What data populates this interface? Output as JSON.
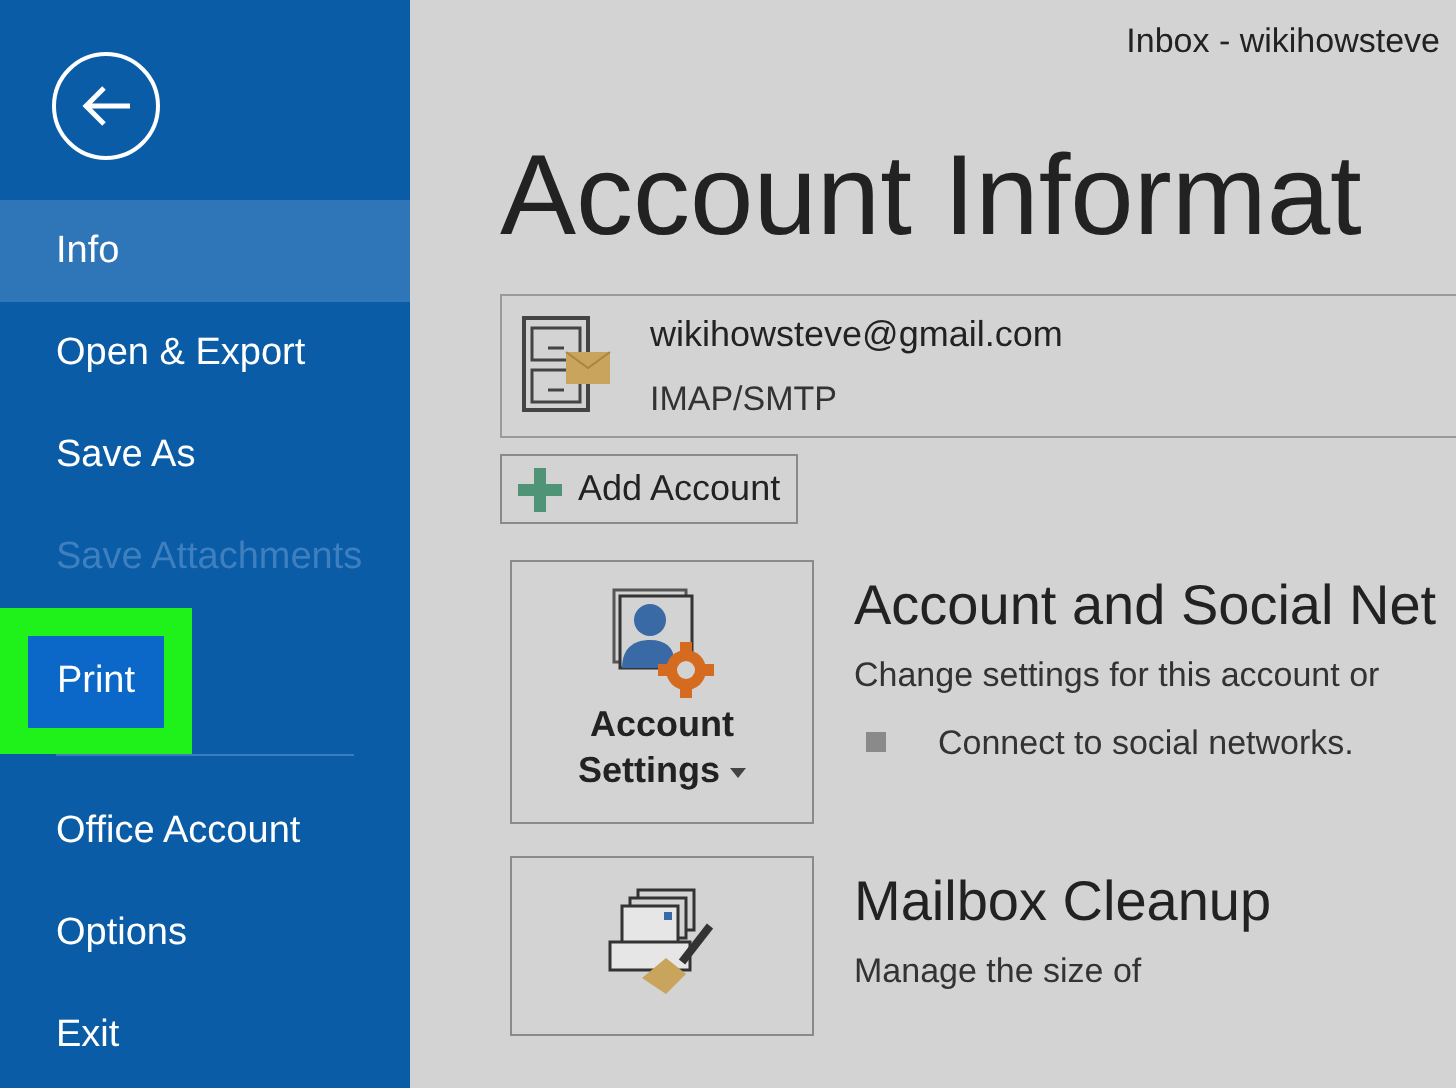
{
  "window": {
    "title": "Inbox - wikihowsteve"
  },
  "sidebar": {
    "groups": [
      [
        {
          "label": "Info",
          "selected": true,
          "disabled": false,
          "highlighted": false
        },
        {
          "label": "Open & Export",
          "selected": false,
          "disabled": false,
          "highlighted": false
        },
        {
          "label": "Save As",
          "selected": false,
          "disabled": false,
          "highlighted": false
        },
        {
          "label": "Save Attachments",
          "selected": false,
          "disabled": true,
          "highlighted": false
        },
        {
          "label": "Print",
          "selected": false,
          "disabled": false,
          "highlighted": true
        }
      ],
      [
        {
          "label": "Office Account",
          "selected": false,
          "disabled": false,
          "highlighted": false
        },
        {
          "label": "Options",
          "selected": false,
          "disabled": false,
          "highlighted": false
        },
        {
          "label": "Exit",
          "selected": false,
          "disabled": false,
          "highlighted": false
        }
      ]
    ]
  },
  "heading": "Account Informat",
  "account": {
    "email": "wikihowsteve@gmail.com",
    "type": "IMAP/SMTP"
  },
  "add_account": "Add Account",
  "sections": [
    {
      "button": [
        "Account",
        "Settings"
      ],
      "dropdown": true,
      "title": "Account and Social Net",
      "description": "Change settings for this account or",
      "bullets": [
        "Connect to social networks."
      ]
    },
    {
      "title": "Mailbox Cleanup",
      "description": "Manage the size of"
    }
  ]
}
